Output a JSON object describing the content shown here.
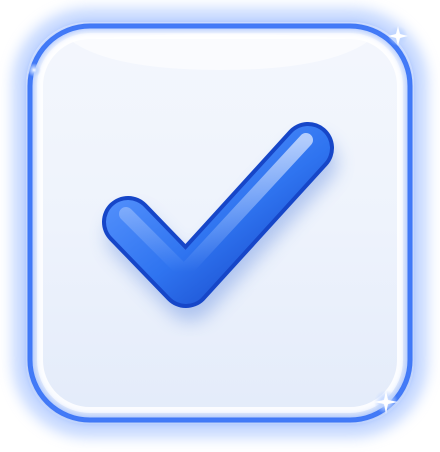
{
  "icon": {
    "name": "checkbox-checked-icon",
    "state": "checked",
    "colors": {
      "frame_stroke": "#1f5ff0",
      "frame_glow": "#8fb4ff",
      "panel_fill": "#eef3fc",
      "check_light": "#7fb0ff",
      "check_mid": "#2f74f0",
      "check_dark": "#1646c8"
    }
  }
}
